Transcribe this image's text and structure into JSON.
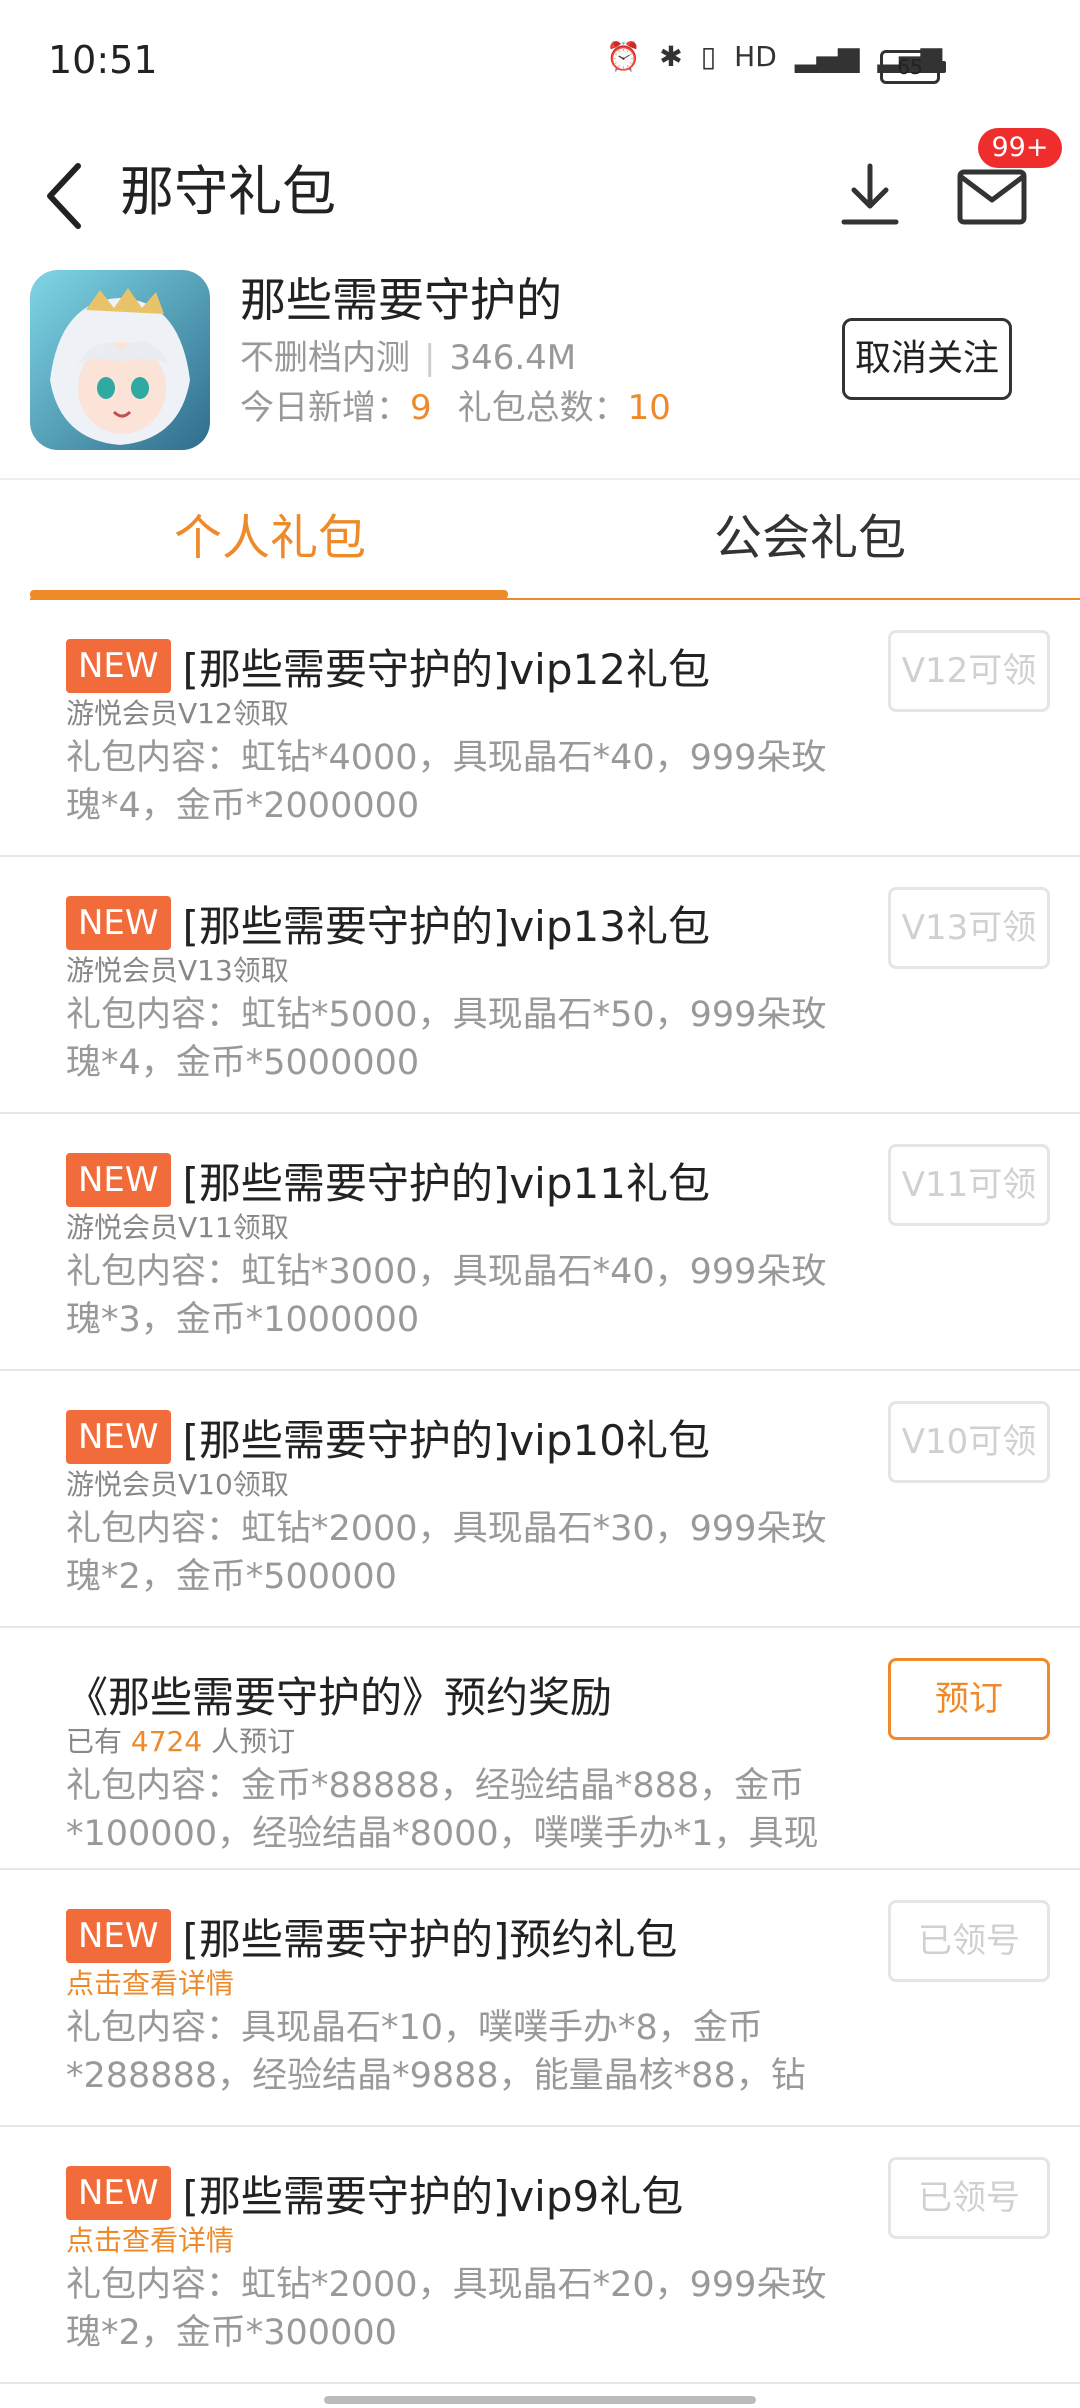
{
  "status_bar": {
    "time": "10:51",
    "battery": "65"
  },
  "header": {
    "title": "那守礼包",
    "mail_badge": "99+"
  },
  "game": {
    "name": "那些需要守护的",
    "tag": "不删档内测",
    "size": "346.4M",
    "today_label": "今日新增：",
    "today_count": "9",
    "total_label": "礼包总数：",
    "total_count": "10",
    "unfollow_label": "取消关注"
  },
  "tabs": [
    {
      "label": "个人礼包",
      "active": true
    },
    {
      "label": "公会礼包",
      "active": false
    }
  ],
  "gifts": [
    {
      "badge": "NEW",
      "title": "[那些需要守护的]vip12礼包",
      "sub": "游悦会员V12领取",
      "desc": "礼包内容：虹钻*4000，具现晶石*40，999朵玫瑰*4，金币*2000000",
      "button": "V12可领"
    },
    {
      "badge": "NEW",
      "title": "[那些需要守护的]vip13礼包",
      "sub": "游悦会员V13领取",
      "desc": "礼包内容：虹钻*5000，具现晶石*50，999朵玫瑰*4，金币*5000000",
      "button": "V13可领"
    },
    {
      "badge": "NEW",
      "title": "[那些需要守护的]vip11礼包",
      "sub": "游悦会员V11领取",
      "desc": "礼包内容：虹钻*3000，具现晶石*40，999朵玫瑰*3，金币*1000000",
      "button": "V11可领"
    },
    {
      "badge": "NEW",
      "title": "[那些需要守护的]vip10礼包",
      "sub": "游悦会员V10领取",
      "desc": "礼包内容：虹钻*2000，具现晶石*30，999朵玫瑰*2，金币*500000",
      "button": "V10可领"
    },
    {
      "title": "《那些需要守护的》预约奖励",
      "sub_prefix": "已有",
      "sub_count": "4724",
      "sub_suffix": "人预订",
      "desc": "礼包内容：金币*88888，经验结晶*888，金币*100000，经验结晶*8000，噗噗手办*1，具现",
      "button": "预订"
    },
    {
      "badge": "NEW",
      "title": "[那些需要守护的]预约礼包",
      "sub": "点击查看详情",
      "desc": "礼包内容：具现晶石*10，噗噗手办*8，金币*288888，经验结晶*9888，能量晶核*88，钻",
      "button": "已领号"
    },
    {
      "badge": "NEW",
      "title": "[那些需要守护的]vip9礼包",
      "sub": "点击查看详情",
      "desc": "礼包内容：虹钻*2000，具现晶石*20，999朵玫瑰*2，金币*300000",
      "button": "已领号"
    }
  ],
  "colors": {
    "accent": "#ee8a2a",
    "new_badge": "#f26b3a",
    "mail_badge": "#ef2d2d"
  }
}
